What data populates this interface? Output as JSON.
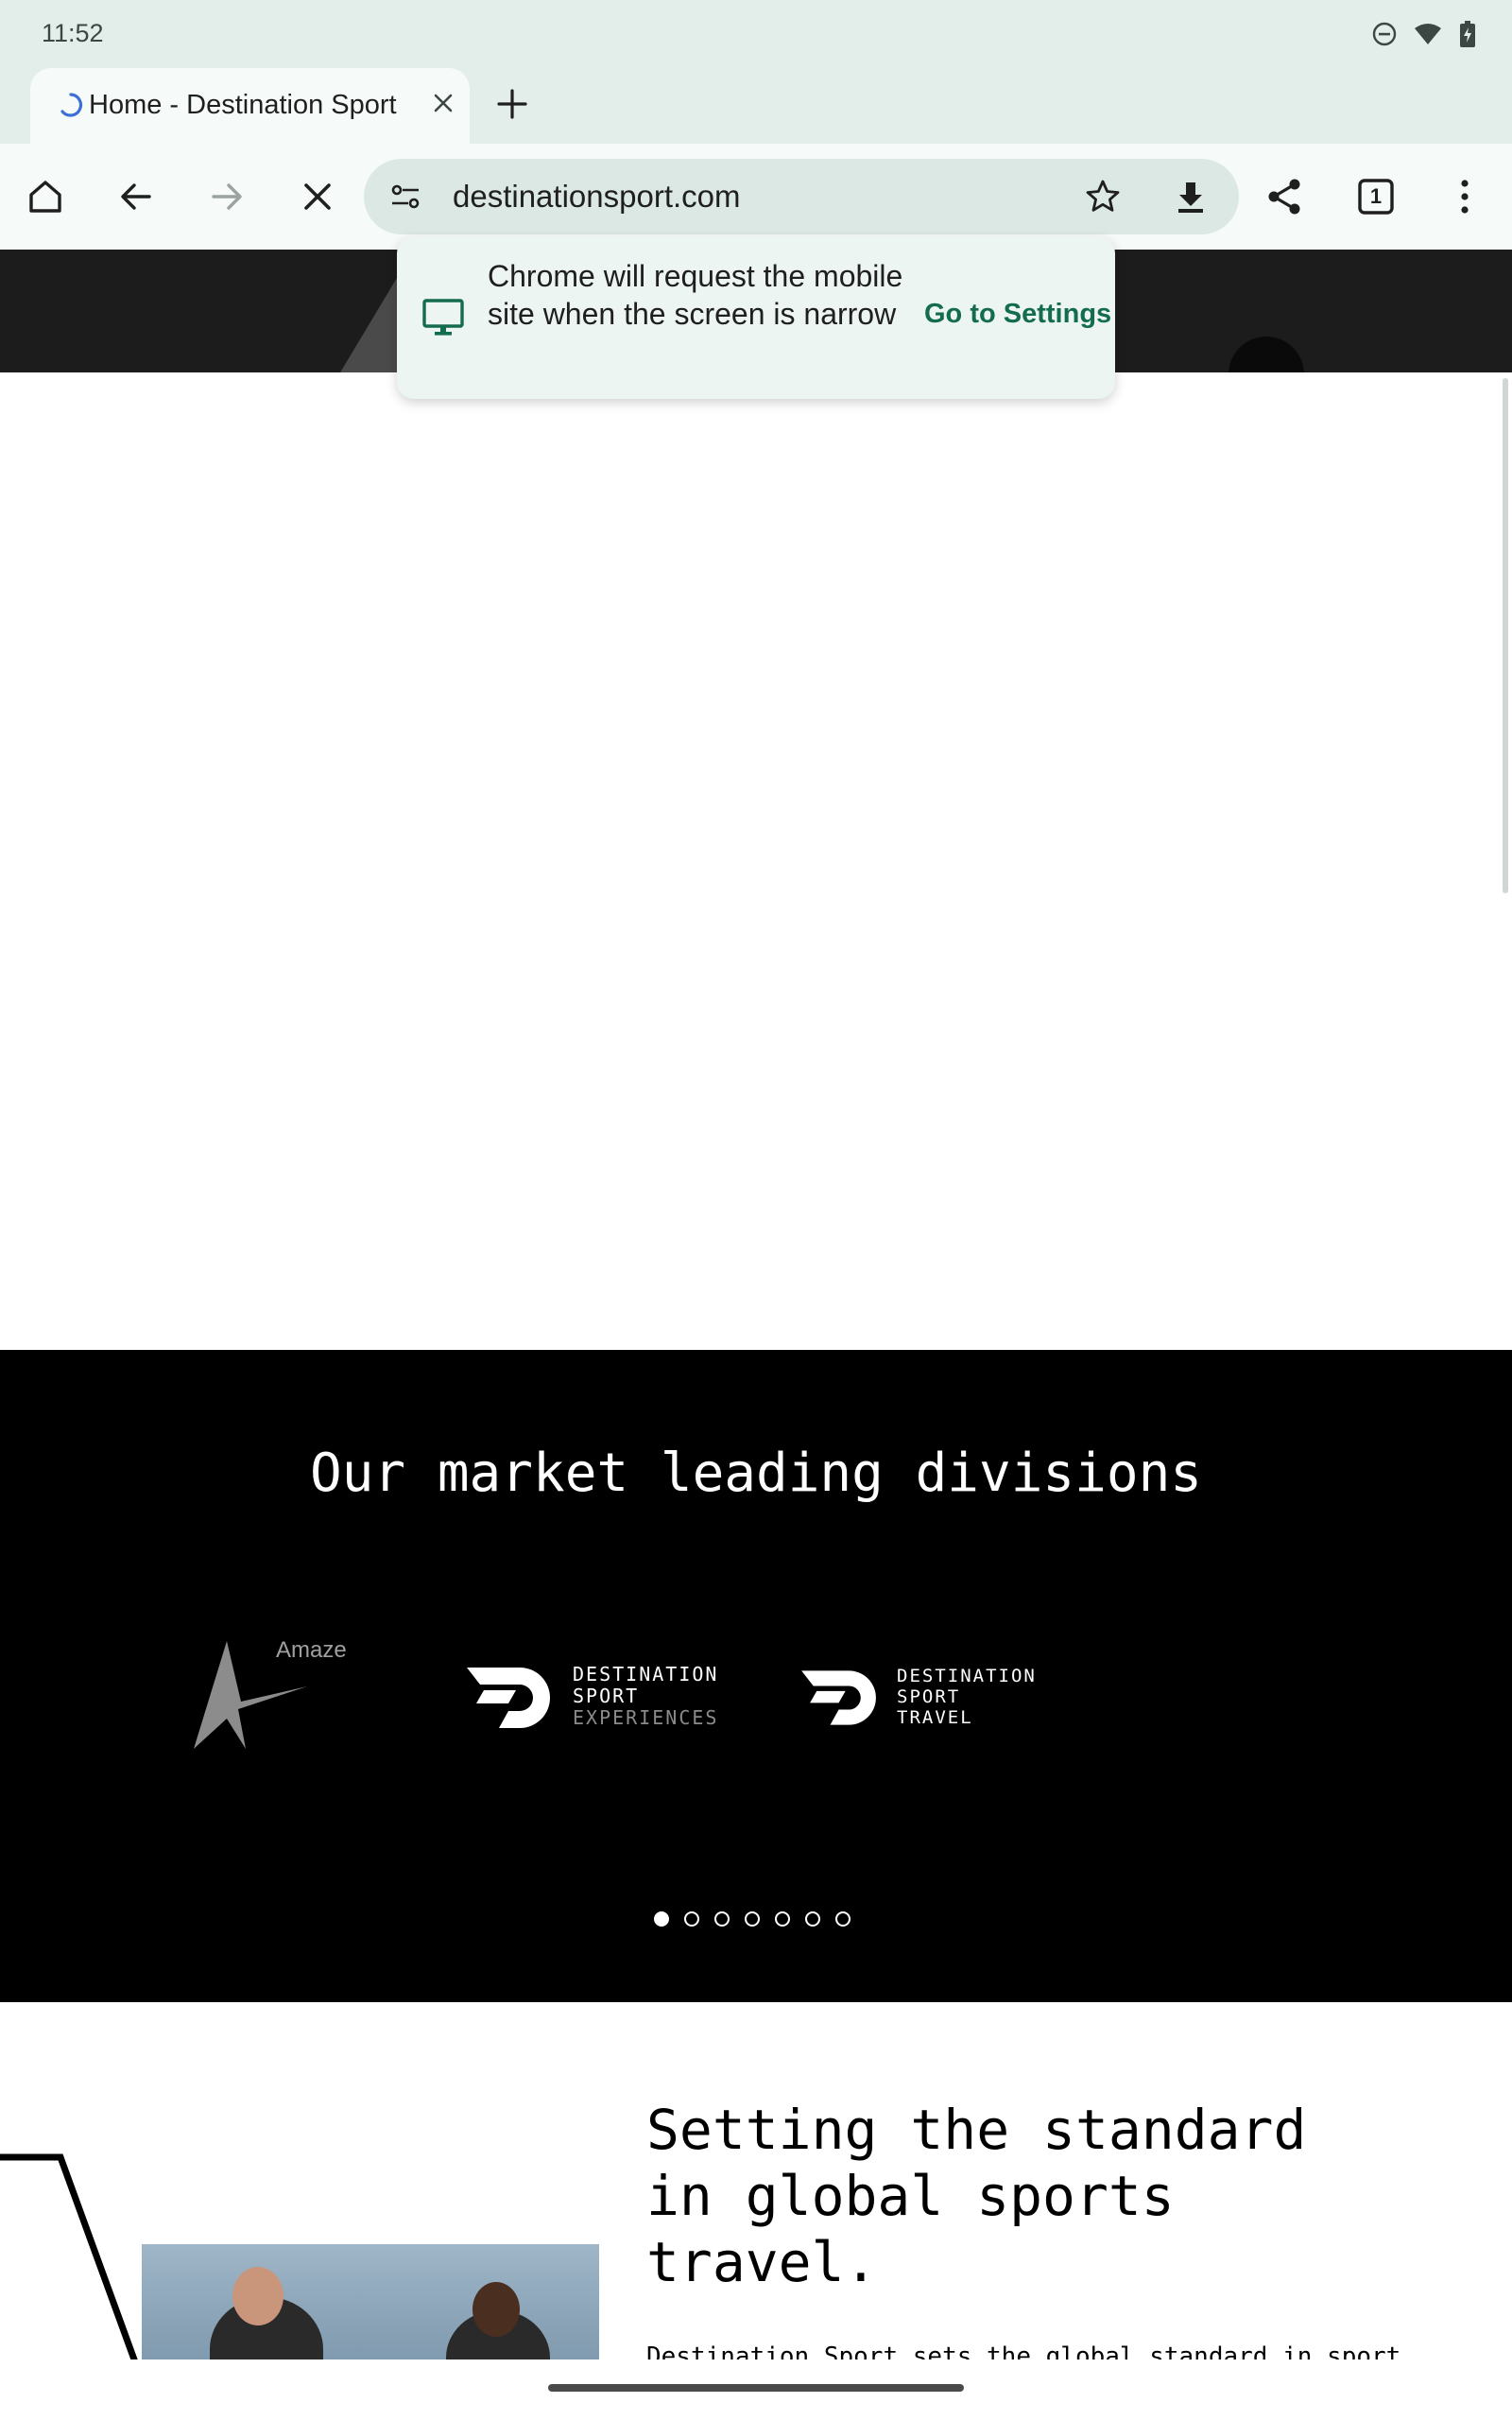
{
  "status_bar": {
    "time": "11:52",
    "icons": [
      "do-not-disturb-icon",
      "wifi-icon",
      "battery-icon"
    ]
  },
  "tab": {
    "title": "Home - Destination Sport"
  },
  "omnibox": {
    "url": "destinationsport.com"
  },
  "toolbar": {
    "tab_count": "1"
  },
  "popup": {
    "message": "Chrome will request the mobile site when the screen is narrow",
    "action": "Go to Settings"
  },
  "divisions": {
    "title": "Our market leading divisions",
    "logos": [
      {
        "text": "Amaze"
      },
      {
        "line1": "DESTINATION",
        "line2": "SPORT",
        "line3": "EXPERIENCES"
      },
      {
        "line1": "DESTINATION",
        "line2": "SPORT",
        "line3": "TRAVEL"
      }
    ],
    "carousel_pages": 7,
    "carousel_active": 1
  },
  "standard": {
    "heading": "Setting the standard in global sports travel.",
    "body_partial": "Destination Sport sets the global standard in sport"
  },
  "colors": {
    "accent": "#146c4e",
    "chrome_bg": "#e3eeeb",
    "page_dark": "#000000"
  }
}
